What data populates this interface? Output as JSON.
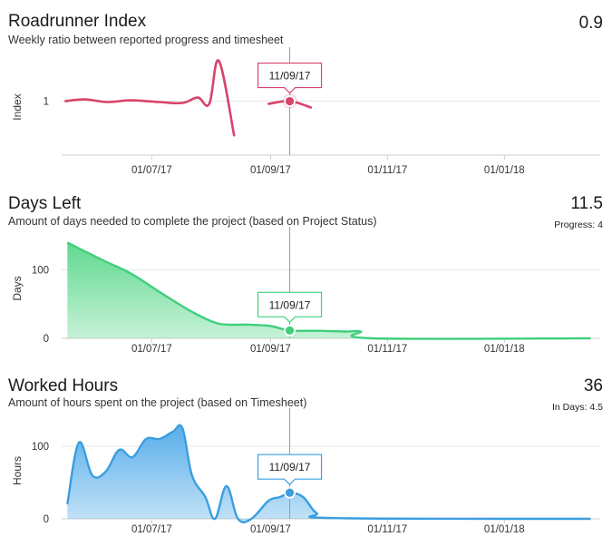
{
  "charts": [
    {
      "title": "Roadrunner Index",
      "subtitle": "Weekly ratio between reported progress and timesheet",
      "value": "0.9",
      "subvalue": "",
      "tooltip": "11/09/17"
    },
    {
      "title": "Days Left",
      "subtitle": "Amount of days needed to complete the project (based on Project Status)",
      "value": "11.5",
      "subvalue": "Progress: 4",
      "tooltip": "11/09/17"
    },
    {
      "title": "Worked Hours",
      "subtitle": "Amount of hours spent on the project (based on Timesheet)",
      "value": "36",
      "subvalue": "In Days: 4.5",
      "tooltip": "11/09/17"
    }
  ],
  "colors": {
    "index_line": "#d9436a",
    "days_line": "#3fcf7c",
    "days_fill_top": "#5fd98f",
    "hours_line": "#3a9ee0",
    "hours_fill_top": "#58aeea",
    "grid": "#e6e6e6",
    "crosshair": "#9a9a9a"
  },
  "chart_data": [
    {
      "type": "line",
      "title": "Roadrunner Index",
      "ylabel": "Index",
      "ylim": [
        0.4,
        1.5
      ],
      "y_ticks": [
        1
      ],
      "x_tick_labels": [
        "01/07/17",
        "01/09/17",
        "01/11/17",
        "01/01/18"
      ],
      "x_tick_dates": [
        "2017-07-01",
        "2017-09-01",
        "2017-11-01",
        "2018-01-01"
      ],
      "xlim": [
        "2017-05-15",
        "2018-02-20"
      ],
      "tooltip_date": "2017-09-11",
      "segments": [
        [
          [
            "2017-05-17",
            1.0
          ],
          [
            "2017-05-27",
            1.02
          ],
          [
            "2017-06-08",
            0.99
          ],
          [
            "2017-06-20",
            1.01
          ],
          [
            "2017-07-05",
            0.99
          ],
          [
            "2017-07-17",
            0.98
          ],
          [
            "2017-07-25",
            1.04
          ],
          [
            "2017-07-31",
            0.97
          ],
          [
            "2017-08-05",
            1.45
          ],
          [
            "2017-08-13",
            0.62
          ]
        ],
        [
          [
            "2017-08-31",
            0.97
          ],
          [
            "2017-09-11",
            1.0
          ],
          [
            "2017-09-22",
            0.93
          ]
        ]
      ]
    },
    {
      "type": "area",
      "title": "Days Left",
      "ylabel": "Days",
      "ylim": [
        0,
        150
      ],
      "y_ticks": [
        0,
        100
      ],
      "x_tick_labels": [
        "01/07/17",
        "01/09/17",
        "01/11/17",
        "01/01/18"
      ],
      "x_tick_dates": [
        "2017-07-01",
        "2017-09-01",
        "2017-11-01",
        "2018-01-01"
      ],
      "xlim": [
        "2017-05-15",
        "2018-02-20"
      ],
      "tooltip_date": "2017-09-11",
      "points": [
        [
          "2017-05-18",
          140
        ],
        [
          "2017-06-05",
          115
        ],
        [
          "2017-06-20",
          95
        ],
        [
          "2017-07-05",
          68
        ],
        [
          "2017-07-20",
          42
        ],
        [
          "2017-08-02",
          24
        ],
        [
          "2017-08-10",
          20
        ],
        [
          "2017-08-20",
          20
        ],
        [
          "2017-09-01",
          18
        ],
        [
          "2017-09-11",
          11.5
        ],
        [
          "2017-09-25",
          11
        ],
        [
          "2017-10-10",
          10
        ],
        [
          "2017-10-18",
          10
        ],
        [
          "2017-10-24",
          0
        ],
        [
          "2018-02-15",
          0
        ]
      ]
    },
    {
      "type": "area",
      "title": "Worked Hours",
      "ylabel": "Hours",
      "ylim": [
        0,
        140
      ],
      "y_ticks": [
        0,
        100
      ],
      "x_tick_labels": [
        "01/07/17",
        "01/09/17",
        "01/11/17",
        "01/01/18"
      ],
      "x_tick_dates": [
        "2017-07-01",
        "2017-09-01",
        "2017-11-01",
        "2018-01-01"
      ],
      "xlim": [
        "2017-05-15",
        "2018-02-20"
      ],
      "tooltip_date": "2017-09-11",
      "points": [
        [
          "2017-05-18",
          20
        ],
        [
          "2017-05-24",
          105
        ],
        [
          "2017-05-31",
          60
        ],
        [
          "2017-06-07",
          65
        ],
        [
          "2017-06-14",
          95
        ],
        [
          "2017-06-21",
          85
        ],
        [
          "2017-06-28",
          110
        ],
        [
          "2017-07-05",
          110
        ],
        [
          "2017-07-12",
          120
        ],
        [
          "2017-07-17",
          125
        ],
        [
          "2017-07-22",
          60
        ],
        [
          "2017-07-29",
          30
        ],
        [
          "2017-08-03",
          0
        ],
        [
          "2017-08-09",
          45
        ],
        [
          "2017-08-15",
          0
        ],
        [
          "2017-08-22",
          0
        ],
        [
          "2017-08-31",
          25
        ],
        [
          "2017-09-06",
          30
        ],
        [
          "2017-09-11",
          36
        ],
        [
          "2017-09-18",
          30
        ],
        [
          "2017-09-25",
          8
        ],
        [
          "2017-10-05",
          1
        ],
        [
          "2018-02-15",
          0
        ]
      ]
    }
  ]
}
